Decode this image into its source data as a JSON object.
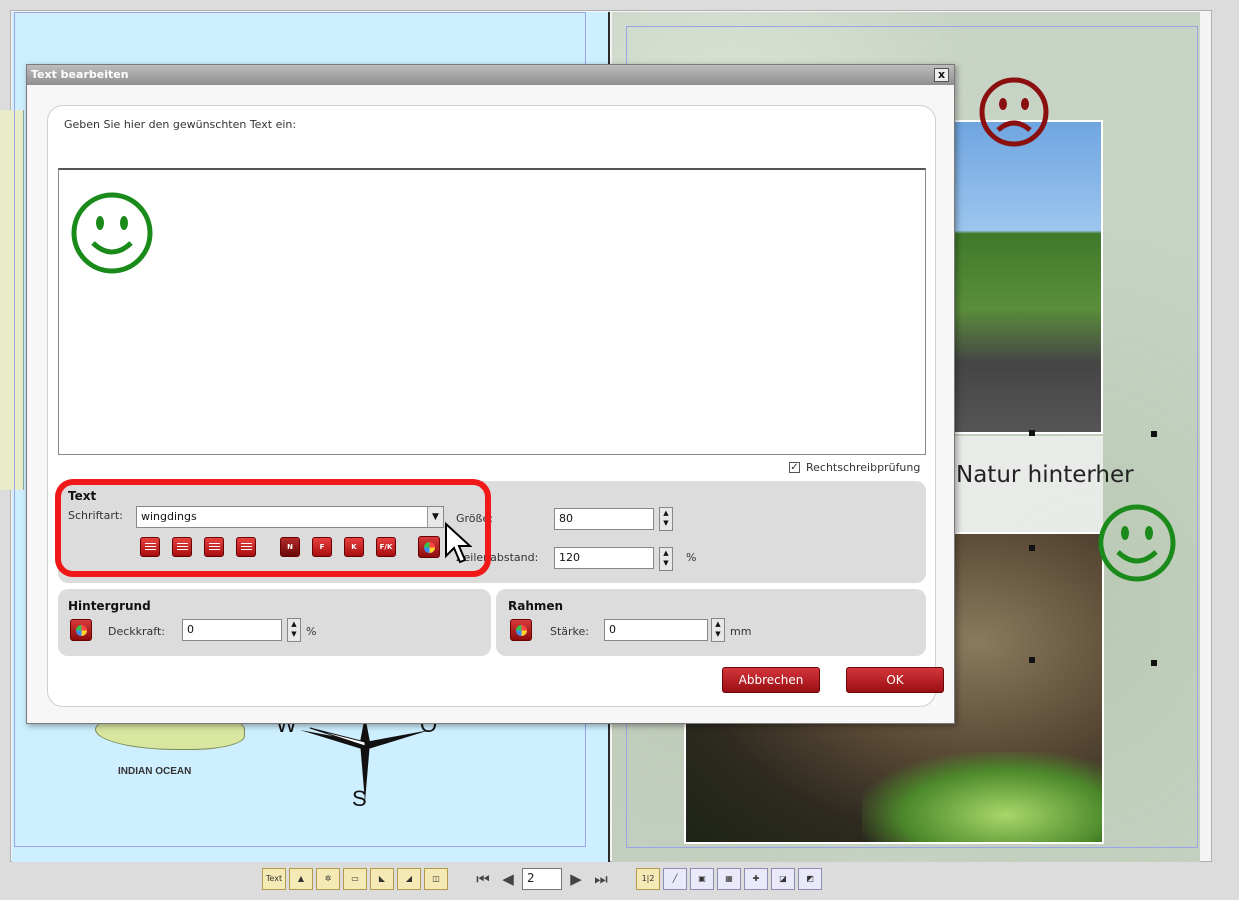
{
  "dialog": {
    "title": "Text bearbeiten",
    "close_label": "x",
    "prompt": "Geben Sie hier den gewünschten Text ein:",
    "editor_content_glyph": "smiley-face",
    "spellcheck": {
      "label": "Rechtschreibprüfung",
      "checked": true,
      "check_mark": "✓"
    },
    "text_group": {
      "title": "Text",
      "font_label": "Schriftart:",
      "font_value": "wingdings",
      "size_label": "Größe:",
      "size_value": "80",
      "line_spacing_label": "Zeilenabstand:",
      "line_spacing_value": "120",
      "line_spacing_unit": "%",
      "style_buttons": [
        "N",
        "F",
        "K",
        "F/K"
      ]
    },
    "background_group": {
      "title": "Hintergrund",
      "opacity_label": "Deckkraft:",
      "opacity_value": "0",
      "unit": "%"
    },
    "frame_group": {
      "title": "Rahmen",
      "strength_label": "Stärke:",
      "strength_value": "0",
      "unit": "mm"
    },
    "cancel_label": "Abbrechen",
    "ok_label": "OK",
    "accent_color": "#b8141b",
    "highlight_color": "#f01818"
  },
  "page": {
    "caption": "Natur hinterher",
    "ocean_label": "INDIAN OCEAN",
    "compass": {
      "w": "W",
      "o": "O",
      "s": "S"
    },
    "smiley_color": "#1a8a1a",
    "sad_color": "#8a1010"
  },
  "toolbar": {
    "text_button": "Text",
    "page_number": "2",
    "two_page_label": "1|2"
  }
}
